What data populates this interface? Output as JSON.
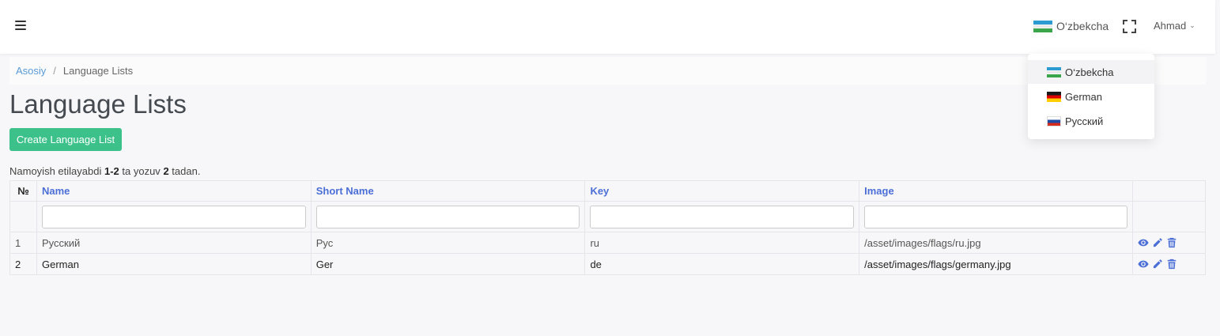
{
  "topbar": {
    "language": {
      "label": "O‘zbekcha",
      "flag": "uz"
    },
    "user": {
      "name": "Ahmad"
    }
  },
  "language_menu": [
    {
      "label": "O‘zbekcha",
      "flag": "uz"
    },
    {
      "label": "German",
      "flag": "de"
    },
    {
      "label": "Русский",
      "flag": "ru"
    }
  ],
  "breadcrumb": {
    "home": "Asosiy",
    "separator": "/",
    "current": "Language Lists"
  },
  "page_title": "Language Lists",
  "create_button": "Create Language List",
  "summary": {
    "prefix": "Namoyish etilayabdi",
    "range": "1-2",
    "middle": "ta yozuv",
    "total": "2",
    "suffix": "tadan."
  },
  "table": {
    "headers": {
      "num": "№",
      "name": "Name",
      "short_name": "Short Name",
      "key": "Key",
      "image": "Image"
    },
    "rows": [
      {
        "num": "1",
        "name": "Русский",
        "short_name": "Рус",
        "key": "ru",
        "image": "/asset/images/flags/ru.jpg"
      },
      {
        "num": "2",
        "name": "German",
        "short_name": "Ger",
        "key": "de",
        "image": "/asset/images/flags/germany.jpg"
      }
    ]
  },
  "colors": {
    "accent": "#4b6fd6",
    "button": "#3cc18a",
    "link": "#5a9bd5"
  },
  "icons": {
    "menu": "hamburger-icon",
    "fullscreen": "fullscreen-icon",
    "view": "eye-icon",
    "edit": "pencil-icon",
    "delete": "trash-icon"
  }
}
